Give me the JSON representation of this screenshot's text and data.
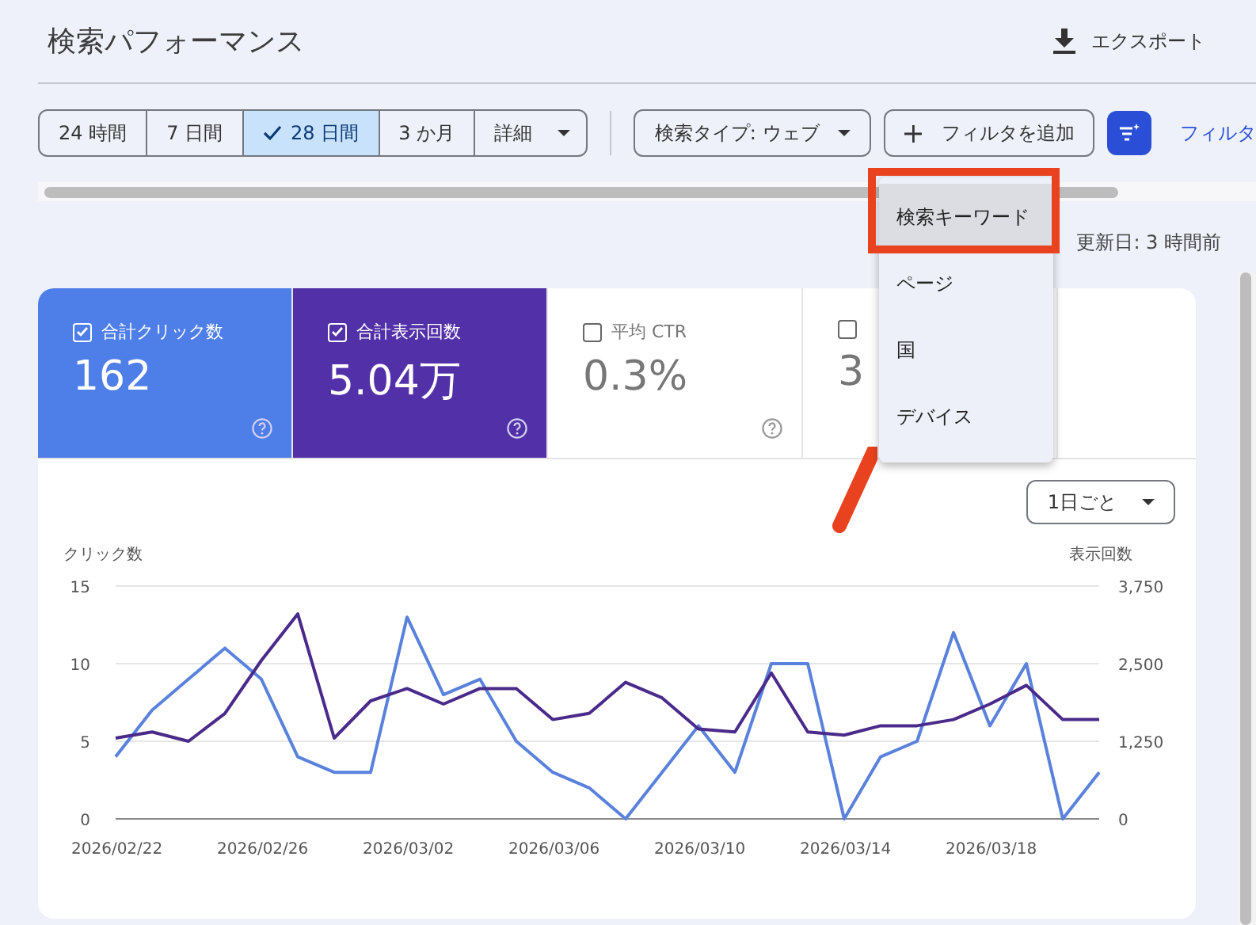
{
  "header": {
    "title": "検索パフォーマンス",
    "export": "エクスポート"
  },
  "date_ranges": [
    {
      "label": "24 時間",
      "selected": false
    },
    {
      "label": "7 日間",
      "selected": false
    },
    {
      "label": "28 日間",
      "selected": true
    },
    {
      "label": "3 か月",
      "selected": false
    }
  ],
  "detail_dropdown": "詳細",
  "search_type": "検索タイプ: ウェブ",
  "add_filter": "フィルタを追加",
  "filter_link": "フィルタ",
  "last_updated": "更新日: 3 時間前",
  "metrics": [
    {
      "label": "合計クリック数",
      "value": "162",
      "checked": true,
      "help": true
    },
    {
      "label": "合計表示回数",
      "value": "5.04万",
      "checked": true,
      "help": true
    },
    {
      "label": "平均 CTR",
      "value": "0.3%",
      "checked": false,
      "help": true
    },
    {
      "value": "3",
      "checked": false
    }
  ],
  "menu": {
    "items": [
      {
        "label": "検索キーワード",
        "selected": true
      },
      {
        "label": "ページ",
        "selected": false
      },
      {
        "label": "国",
        "selected": false
      },
      {
        "label": "デバイス",
        "selected": false
      }
    ]
  },
  "granularity": "1日ごと",
  "chart_data": {
    "type": "line",
    "ylabel": "クリック数",
    "y2label": "表示回数",
    "ylim": [
      0,
      15
    ],
    "y2lim": [
      0,
      3750
    ],
    "yticks": [
      0,
      5,
      10,
      15
    ],
    "y2ticks": [
      {
        "value": 0,
        "label": "0"
      },
      {
        "value": 1250,
        "label": "1,250"
      },
      {
        "value": 2500,
        "label": "2,500"
      },
      {
        "value": 3750,
        "label": "3,750"
      }
    ],
    "categories": [
      "2026/02/22",
      null,
      null,
      null,
      "2026/02/26",
      null,
      null,
      null,
      "2026/03/02",
      null,
      null,
      null,
      "2026/03/06",
      null,
      null,
      null,
      "2026/03/10",
      null,
      null,
      null,
      "2026/03/14",
      null,
      null,
      null,
      "2026/03/18",
      null,
      null,
      null
    ],
    "series": [
      {
        "color": "#5a82dc",
        "values": [
          4,
          7,
          9,
          11,
          9,
          4,
          3,
          3,
          13,
          8,
          9,
          5,
          3,
          2,
          0,
          3,
          6,
          3,
          10,
          10,
          0,
          4,
          5,
          12,
          6,
          10,
          0,
          3
        ]
      },
      {
        "color": "#4a2a8a",
        "axis": "y2",
        "values": [
          1300,
          1400,
          1250,
          1700,
          2550,
          3300,
          1300,
          1900,
          2100,
          1850,
          2100,
          2100,
          1600,
          1700,
          2200,
          1950,
          1450,
          1400,
          2350,
          1400,
          1350,
          1500,
          1500,
          1600,
          1850,
          2150,
          1600,
          1600
        ]
      }
    ]
  }
}
